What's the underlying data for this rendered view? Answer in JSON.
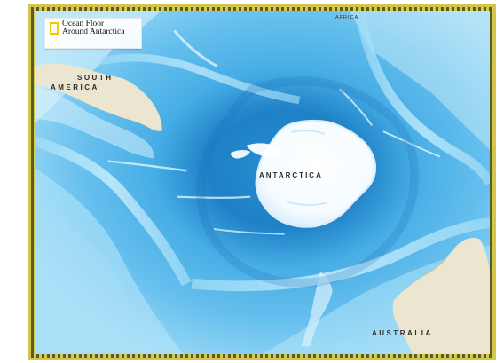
{
  "map": {
    "title": "Ocean Floor Around Antarctica",
    "title_line_1": "Ocean Floor",
    "title_line_2": "Around Antarctica",
    "labels": {
      "south_america": "SOUTH AMERICA",
      "south_america_top": "SOUTH",
      "south_america_bottom": "AMERICA",
      "antarctica": "ANTARCTICA",
      "australia": "AUSTRALIA",
      "africa": "AFRICA"
    },
    "colors": {
      "ocean_light": "#8fd0f2",
      "ocean_mid": "#3aa2df",
      "ocean_deep": "#2b8fd0",
      "land": "#ece6d0",
      "ice": "#ffffff",
      "frame_gold": "#d4c64a",
      "frame_dark": "#5b5a2a"
    },
    "logo": "national-geographic-logo"
  }
}
